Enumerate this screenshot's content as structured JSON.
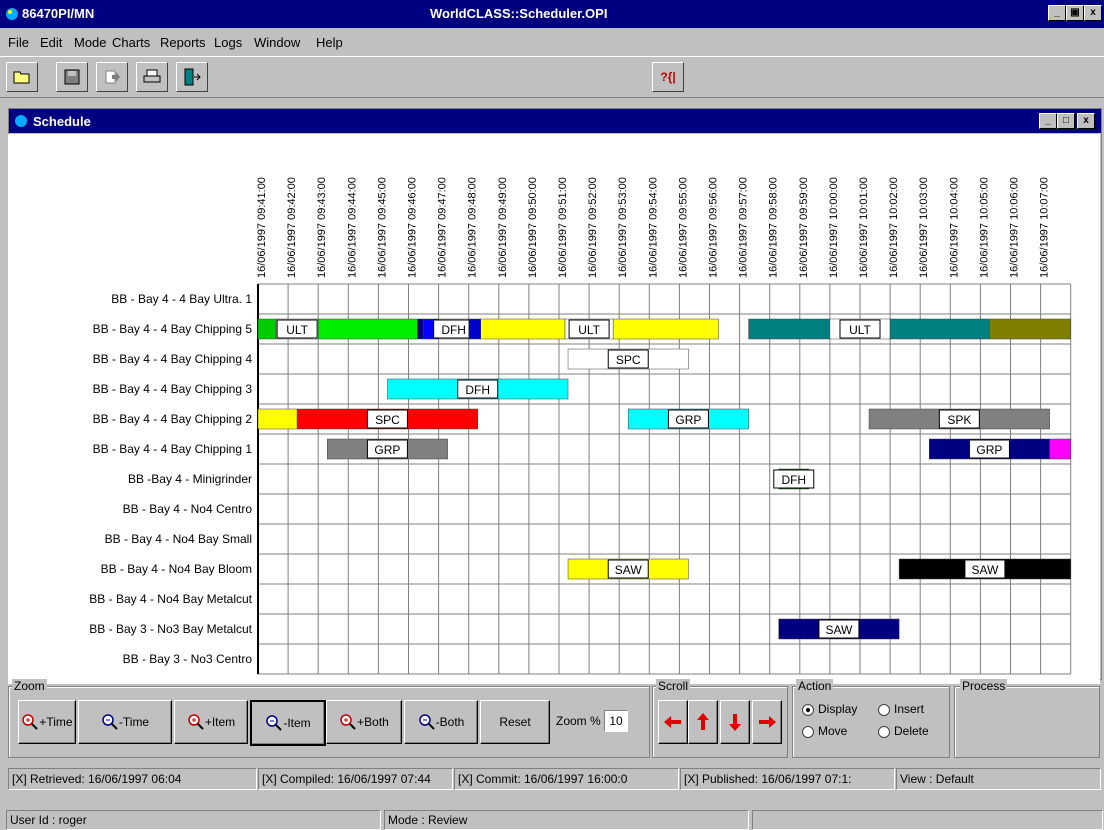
{
  "window": {
    "title_left": "86470PI/MN",
    "title_center": "WorldCLASS::Scheduler.OPI"
  },
  "menu": [
    "File",
    "Edit",
    "Mode",
    "Charts",
    "Reports",
    "Logs",
    "Window",
    "Help"
  ],
  "toolbar": {
    "help_glyph": "?{|"
  },
  "mdi": {
    "title": "Schedule"
  },
  "timeline": [
    "16/06/1997 09:41:00",
    "16/06/1997 09:42:00",
    "16/06/1997 09:43:00",
    "16/06/1997 09:44:00",
    "16/06/1997 09:45:00",
    "16/06/1997 09:46:00",
    "16/06/1997 09:47:00",
    "16/06/1997 09:48:00",
    "16/06/1997 09:49:00",
    "16/06/1997 09:50:00",
    "16/06/1997 09:51:00",
    "16/06/1997 09:52:00",
    "16/06/1997 09:53:00",
    "16/06/1997 09:54:00",
    "16/06/1997 09:55:00",
    "16/06/1997 09:56:00",
    "16/06/1997 09:57:00",
    "16/06/1997 09:58:00",
    "16/06/1997 09:59:00",
    "16/06/1997 10:00:00",
    "16/06/1997 10:01:00",
    "16/06/1997 10:02:00",
    "16/06/1997 10:03:00",
    "16/06/1997 10:04:00",
    "16/06/1997 10:05:00",
    "16/06/1997 10:06:00",
    "16/06/1997 10:07:00"
  ],
  "rows": [
    "BB - Bay 4 - 4 Bay Ultra. 1",
    "BB - Bay 4 - 4 Bay Chipping 5",
    "BB - Bay 4 - 4 Bay Chipping 4",
    "BB - Bay 4 - 4 Bay Chipping 3",
    "BB - Bay 4 - 4 Bay Chipping 2",
    "BB - Bay 4 - 4 Bay Chipping 1",
    "BB -Bay 4 - Minigrinder",
    "BB - Bay 4 - No4 Centro",
    "BB - Bay 4 - No4 Bay Small",
    "BB - Bay 4 - No4 Bay Bloom",
    "BB - Bay 4 - No4 Bay Metalcut",
    "BB - Bay 3 - No3 Bay Metalcut",
    "BB - Bay 3 - No3 Centro"
  ],
  "gantt": [
    {
      "row": 1,
      "start": 0,
      "end": 0.6,
      "color": "#00cc00"
    },
    {
      "row": 1,
      "start": 0.6,
      "end": 2.0,
      "color": "#ffffff",
      "label": "ULT"
    },
    {
      "row": 1,
      "start": 2.0,
      "end": 5.3,
      "color": "#00ee00"
    },
    {
      "row": 1,
      "start": 5.3,
      "end": 5.5,
      "color": "#000080"
    },
    {
      "row": 1,
      "start": 5.5,
      "end": 6.0,
      "color": "#0000ff"
    },
    {
      "row": 1,
      "start": 6.0,
      "end": 7.0,
      "color": "#ffffff",
      "label": "DFH"
    },
    {
      "row": 1,
      "start": 7.0,
      "end": 7.4,
      "color": "#0000cc"
    },
    {
      "row": 1,
      "start": 7.4,
      "end": 10.2,
      "color": "#ffff00"
    },
    {
      "row": 1,
      "start": 10.2,
      "end": 11.8,
      "color": "#ffffff",
      "label": "ULT"
    },
    {
      "row": 1,
      "start": 11.8,
      "end": 15.3,
      "color": "#ffff00"
    },
    {
      "row": 1,
      "start": 16.3,
      "end": 19.0,
      "color": "#008080"
    },
    {
      "row": 1,
      "start": 19.0,
      "end": 21.0,
      "color": "#ffffff",
      "label": "ULT"
    },
    {
      "row": 1,
      "start": 21.0,
      "end": 24.3,
      "color": "#008080"
    },
    {
      "row": 1,
      "start": 24.3,
      "end": 27.0,
      "color": "#808000"
    },
    {
      "row": 2,
      "start": 10.3,
      "end": 14.3,
      "color": "#ffffff",
      "label": "SPC"
    },
    {
      "row": 3,
      "start": 4.3,
      "end": 10.3,
      "color": "#00ffff",
      "label": "DFH"
    },
    {
      "row": 4,
      "start": 0,
      "end": 1.3,
      "color": "#ffff00"
    },
    {
      "row": 4,
      "start": 1.3,
      "end": 7.3,
      "color": "#ff0000",
      "label": "SPC"
    },
    {
      "row": 4,
      "start": 12.3,
      "end": 16.3,
      "color": "#00ffff",
      "label": "GRP"
    },
    {
      "row": 4,
      "start": 20.3,
      "end": 26.3,
      "color": "#808080",
      "label": "SPK"
    },
    {
      "row": 5,
      "start": 2.3,
      "end": 6.3,
      "color": "#808080",
      "label": "GRP"
    },
    {
      "row": 5,
      "start": 22.3,
      "end": 26.3,
      "color": "#000080",
      "label": "GRP"
    },
    {
      "row": 5,
      "start": 26.3,
      "end": 27.0,
      "color": "#ff00ff"
    },
    {
      "row": 6,
      "start": 17.3,
      "end": 18.3,
      "color": "#008000",
      "label": "DFH"
    },
    {
      "row": 9,
      "start": 10.3,
      "end": 14.3,
      "color": "#ffff00",
      "label": "SAW"
    },
    {
      "row": 9,
      "start": 21.3,
      "end": 27.0,
      "color": "#000000",
      "label": "SAW"
    },
    {
      "row": 11,
      "start": 17.3,
      "end": 21.3,
      "color": "#000080",
      "label": "SAW"
    }
  ],
  "panels": {
    "zoom": {
      "legend": "Zoom",
      "buttons": [
        "+Time",
        "-Time",
        "+Item",
        "-Item",
        "+Both",
        "-Both"
      ],
      "reset_label": "Reset",
      "zoom_label": "Zoom %",
      "zoom_value": "10"
    },
    "scroll": {
      "legend": "Scroll"
    },
    "action": {
      "legend": "Action",
      "options": [
        "Display",
        "Insert",
        "Move",
        "Delete"
      ],
      "selected": "Display"
    },
    "process": {
      "legend": "Process"
    }
  },
  "status": {
    "retrieved": "[X] Retrieved: 16/06/1997 06:04",
    "compiled": "[X] Compiled: 16/06/1997 07:44",
    "commit": "[X] Commit: 16/06/1997 16:00:0",
    "published": "[X] Published: 16/06/1997 07:1:",
    "view": "View : Default"
  },
  "bottombar": {
    "user": "User Id : roger",
    "mode": "Mode : Review"
  },
  "colors": {
    "titlebar": "#000080",
    "face": "#c0c0c0"
  }
}
